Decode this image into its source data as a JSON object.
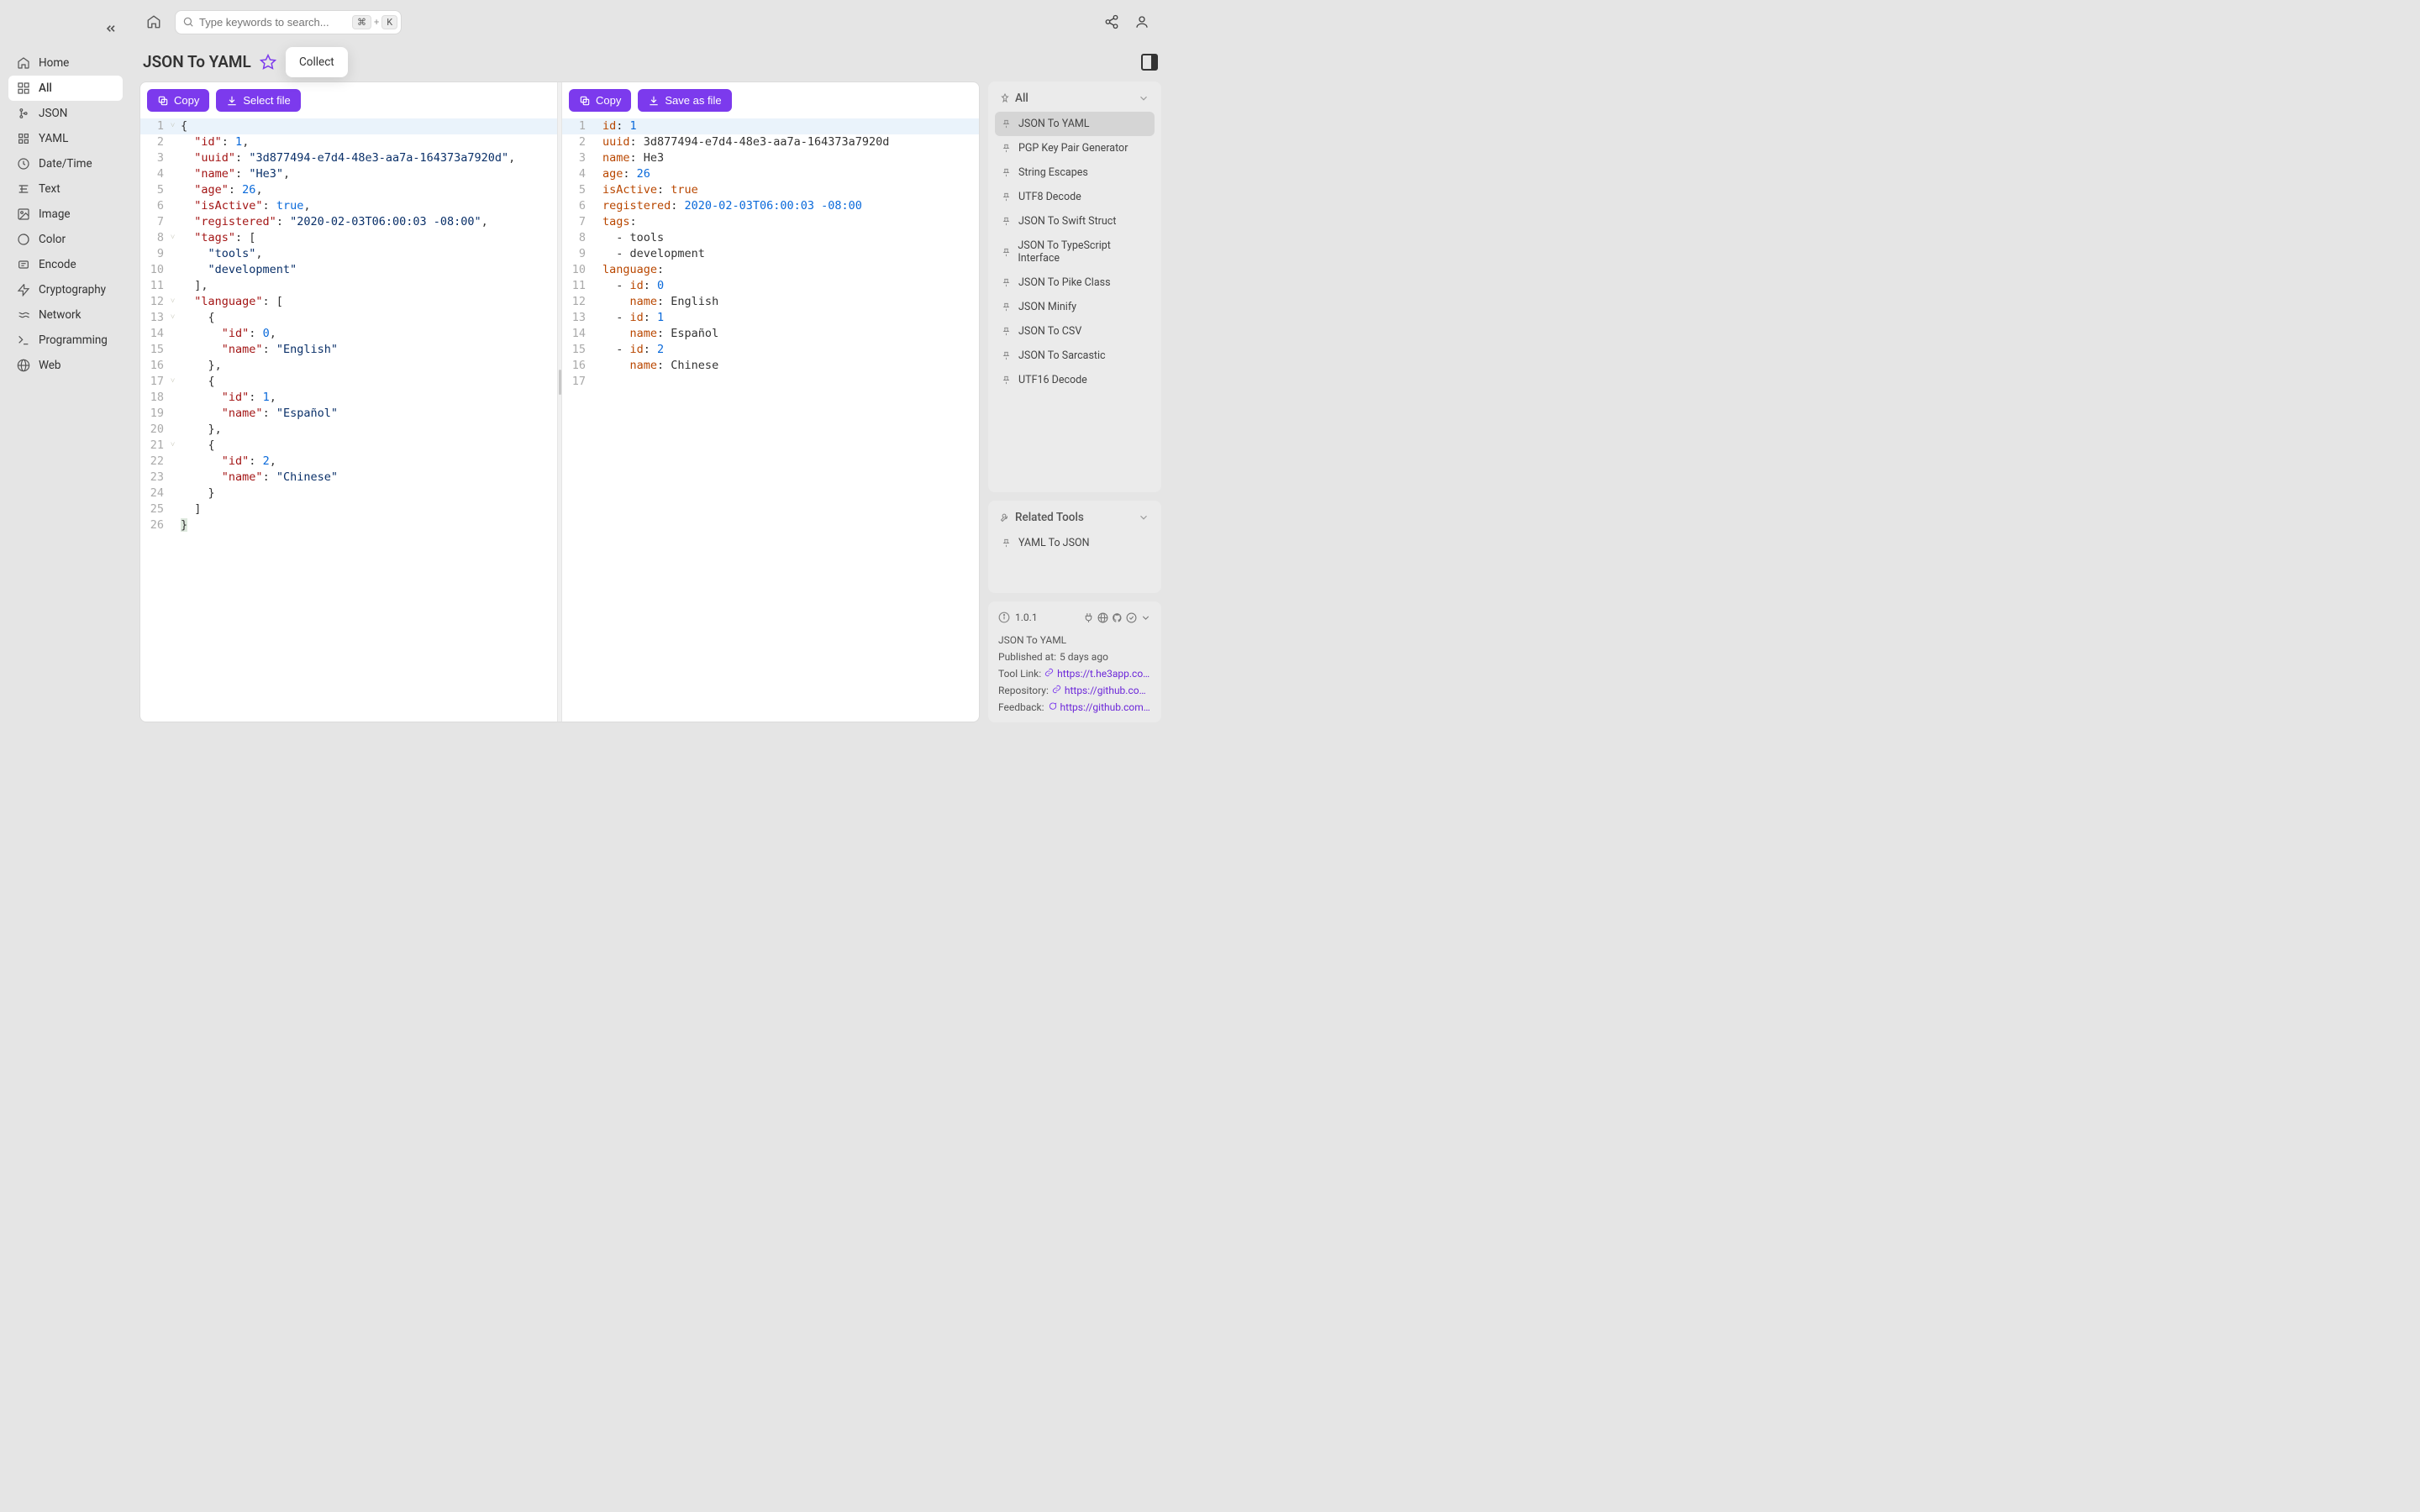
{
  "search": {
    "placeholder": "Type keywords to search...",
    "shortcut_mod": "⌘",
    "shortcut_plus": "+",
    "shortcut_key": "K"
  },
  "sidebar": {
    "items": [
      {
        "label": "Home"
      },
      {
        "label": "All"
      },
      {
        "label": "JSON"
      },
      {
        "label": "YAML"
      },
      {
        "label": "Date/Time"
      },
      {
        "label": "Text"
      },
      {
        "label": "Image"
      },
      {
        "label": "Color"
      },
      {
        "label": "Encode"
      },
      {
        "label": "Cryptography"
      },
      {
        "label": "Network"
      },
      {
        "label": "Programming"
      },
      {
        "label": "Web"
      }
    ]
  },
  "page": {
    "title": "JSON To YAML",
    "collect_tooltip": "Collect"
  },
  "toolbar": {
    "left": {
      "copy": "Copy",
      "select_file": "Select file"
    },
    "right": {
      "copy": "Copy",
      "save_file": "Save as file"
    }
  },
  "rail": {
    "all_header": "All",
    "all_items": [
      "JSON To YAML",
      "PGP Key Pair Generator",
      "String Escapes",
      "UTF8 Decode",
      "JSON To Swift Struct",
      "JSON To TypeScript Interface",
      "JSON To Pike Class",
      "JSON Minify",
      "JSON To CSV",
      "JSON To Sarcastic",
      "UTF16 Decode"
    ],
    "related_header": "Related Tools",
    "related_items": [
      "YAML To JSON"
    ]
  },
  "info": {
    "version": "1.0.1",
    "title": "JSON To YAML",
    "published_label": "Published at:",
    "published_value": "5 days ago",
    "tool_link_label": "Tool Link:",
    "tool_link_value": "https://t.he3app.co…",
    "repo_label": "Repository:",
    "repo_value": "https://github.com…",
    "feedback_label": "Feedback:",
    "feedback_value": "https://github.com/…"
  },
  "json_input": {
    "id": 1,
    "uuid": "3d877494-e7d4-48e3-aa7a-164373a7920d",
    "name": "He3",
    "age": 26,
    "isActive": true,
    "registered": "2020-02-03T06:00:03 -08:00",
    "tags": [
      "tools",
      "development"
    ],
    "language": [
      {
        "id": 0,
        "name": "English"
      },
      {
        "id": 1,
        "name": "Español"
      },
      {
        "id": 2,
        "name": "Chinese"
      }
    ]
  },
  "yaml_output_lines": [
    {
      "key": "id",
      "value": "1",
      "type": "num"
    },
    {
      "key": "uuid",
      "value": "3d877494-e7d4-48e3-aa7a-164373a7920d",
      "type": "str"
    },
    {
      "key": "name",
      "value": "He3",
      "type": "str"
    },
    {
      "key": "age",
      "value": "26",
      "type": "num"
    },
    {
      "key": "isActive",
      "value": "true",
      "type": "bool"
    },
    {
      "key": "registered",
      "value": "2020-02-03T06:00:03 -08:00",
      "type": "date"
    },
    {
      "key": "tags",
      "value": "",
      "type": "header"
    },
    {
      "raw": "  - tools"
    },
    {
      "raw": "  - development"
    },
    {
      "key": "language",
      "value": "",
      "type": "header"
    },
    {
      "raw_key_line": true,
      "indent": "  - ",
      "key": "id",
      "value": "0",
      "type": "num"
    },
    {
      "raw_key_line": true,
      "indent": "    ",
      "key": "name",
      "value": "English",
      "type": "str"
    },
    {
      "raw_key_line": true,
      "indent": "  - ",
      "key": "id",
      "value": "1",
      "type": "num"
    },
    {
      "raw_key_line": true,
      "indent": "    ",
      "key": "name",
      "value": "Español",
      "type": "str"
    },
    {
      "raw_key_line": true,
      "indent": "  - ",
      "key": "id",
      "value": "2",
      "type": "num"
    },
    {
      "raw_key_line": true,
      "indent": "    ",
      "key": "name",
      "value": "Chinese",
      "type": "str"
    }
  ]
}
